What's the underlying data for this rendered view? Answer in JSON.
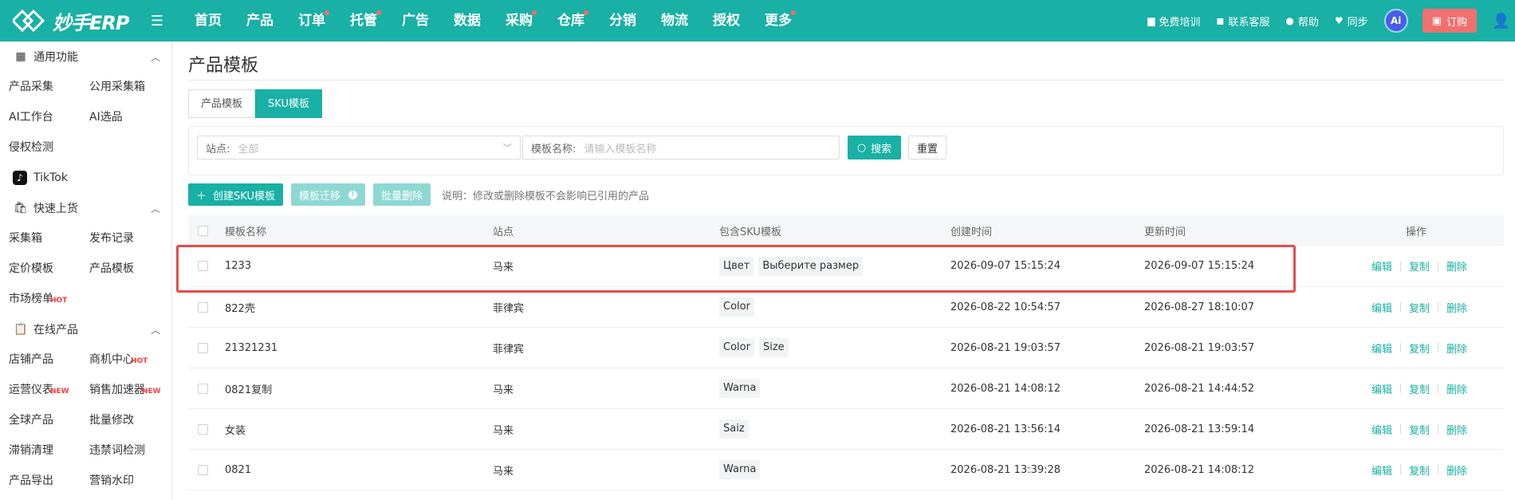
{
  "app": {
    "logo_text": "妙手ERP"
  },
  "topnav": {
    "items": [
      {
        "label": "首页",
        "dot": false
      },
      {
        "label": "产品",
        "dot": false
      },
      {
        "label": "订单",
        "dot": true
      },
      {
        "label": "托管",
        "dot": true
      },
      {
        "label": "广告",
        "dot": false
      },
      {
        "label": "数据",
        "dot": false
      },
      {
        "label": "采购",
        "dot": true
      },
      {
        "label": "仓库",
        "dot": true
      },
      {
        "label": "分销",
        "dot": false
      },
      {
        "label": "物流",
        "dot": false
      },
      {
        "label": "授权",
        "dot": false
      },
      {
        "label": "更多",
        "dot": true
      }
    ],
    "training": "免费培训",
    "support": "联系客服",
    "help": "帮助",
    "sync": "同步",
    "ai_label": "Ai",
    "order": "订购",
    "accent": "#19b0a5"
  },
  "sidebar": {
    "common": {
      "title": "通用功能",
      "links": [
        "产品采集",
        "公用采集箱",
        "AI工作台",
        "AI选品",
        "侵权检测"
      ]
    },
    "tiktok": "TikTok",
    "quick": {
      "title": "快速上货",
      "links": [
        "采集箱",
        "发布记录",
        "定价模板",
        "产品模板",
        "市场榜单"
      ],
      "hot_tag": "HOT"
    },
    "online": {
      "title": "在线产品",
      "links": [
        "店铺产品",
        "商机中心",
        "运营仪表",
        "销售加速器",
        "全球产品",
        "批量修改",
        "滞销清理",
        "违禁词检测",
        "产品导出",
        "营销水印"
      ],
      "hot_tag": "HOT",
      "new_tag": "NEW"
    }
  },
  "page": {
    "title": "产品模板",
    "tabs": [
      "产品模板",
      "SKU模板"
    ],
    "active_tab": 1
  },
  "filter": {
    "site_label": "站点:",
    "site_value": "全部",
    "name_label": "模板名称:",
    "name_placeholder": "请输入模板名称",
    "search": "搜索",
    "reset": "重置"
  },
  "actions": {
    "create": "创建SKU模板",
    "migrate": "模板迁移",
    "batch_delete": "批量删除",
    "note": "说明：修改或删除模板不会影响已引用的产品"
  },
  "table": {
    "headers": {
      "name": "模板名称",
      "site": "站点",
      "sku": "包含SKU模板",
      "created": "创建时间",
      "updated": "更新时间",
      "ops": "操作"
    },
    "ops": {
      "edit": "编辑",
      "copy": "复制",
      "delete": "删除"
    },
    "rows": [
      {
        "name": "1233",
        "site": "马来",
        "skus": [
          "Цвет",
          "Выберите размер"
        ],
        "created": "2026-09-07 15:15:24",
        "updated": "2026-09-07 15:15:24"
      },
      {
        "name": "822壳",
        "site": "菲律宾",
        "skus": [
          "Color"
        ],
        "created": "2026-08-22 10:54:57",
        "updated": "2026-08-27 18:10:07"
      },
      {
        "name": "21321231",
        "site": "菲律宾",
        "skus": [
          "Color",
          "Size"
        ],
        "created": "2026-08-21 19:03:57",
        "updated": "2026-08-21 19:03:57"
      },
      {
        "name": "0821复制",
        "site": "马来",
        "skus": [
          "Warna"
        ],
        "created": "2026-08-21 14:08:12",
        "updated": "2026-08-21 14:44:52"
      },
      {
        "name": "女装",
        "site": "马来",
        "skus": [
          "Saiz"
        ],
        "created": "2026-08-21 13:56:14",
        "updated": "2026-08-21 13:59:14"
      },
      {
        "name": "0821",
        "site": "马来",
        "skus": [
          "Warna"
        ],
        "created": "2026-08-21 13:39:28",
        "updated": "2026-08-21 14:08:12"
      }
    ]
  }
}
